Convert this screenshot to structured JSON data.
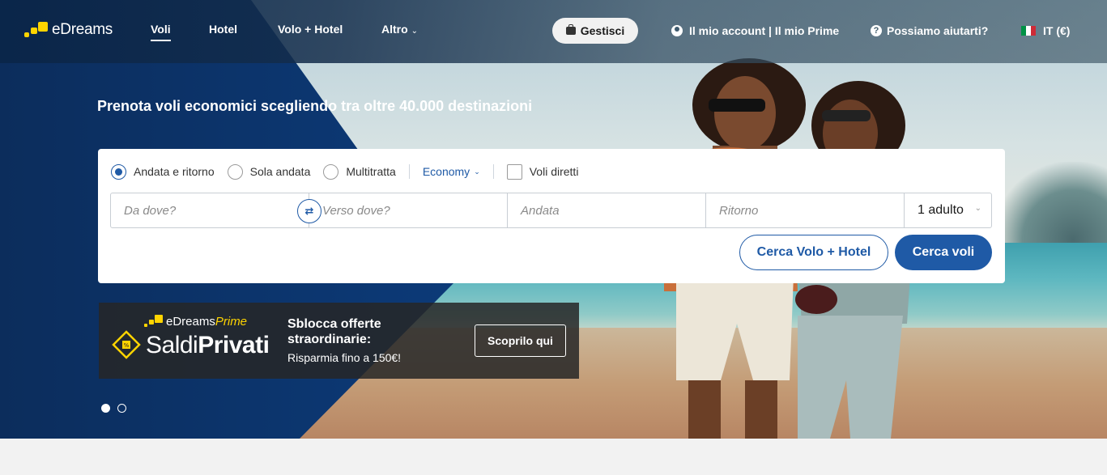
{
  "brand": {
    "name": "eDreams"
  },
  "nav": {
    "items": [
      {
        "label": "Voli",
        "active": true
      },
      {
        "label": "Hotel"
      },
      {
        "label": "Volo + Hotel"
      },
      {
        "label": "Altro"
      }
    ],
    "manage_label": "Gestisci",
    "account_label": "Il mio account | Il mio Prime",
    "help_label": "Possiamo aiutarti?",
    "help_icon": "?",
    "lang_label": "IT (€)"
  },
  "hero": {
    "headline": "Prenota voli economici scegliendo tra oltre 40.000 destinazioni"
  },
  "search": {
    "trip_types": [
      {
        "label": "Andata e ritorno",
        "selected": true
      },
      {
        "label": "Sola andata",
        "selected": false
      },
      {
        "label": "Multitratta",
        "selected": false
      }
    ],
    "cabin_class": "Economy",
    "direct_only_label": "Voli diretti",
    "direct_only_checked": false,
    "from_placeholder": "Da dove?",
    "to_placeholder": "Verso dove?",
    "depart_placeholder": "Andata",
    "return_placeholder": "Ritorno",
    "passengers": "1 adulto",
    "btn_flight_hotel": "Cerca Volo + Hotel",
    "btn_flights": "Cerca voli"
  },
  "prime_banner": {
    "brand_e": "eDreams",
    "brand_prime": "Prime",
    "saldi_light": "Saldi",
    "saldi_bold": "Privati",
    "title": "Sblocca offerte straordinarie:",
    "subtitle": "Risparmia fino a 150€!",
    "cta": "Scoprilo qui"
  },
  "carousel": {
    "slides": 2,
    "active": 0
  },
  "colors": {
    "primary": "#1f5aa6",
    "brand_yellow": "#ffd400",
    "navy": "#0a2548"
  }
}
